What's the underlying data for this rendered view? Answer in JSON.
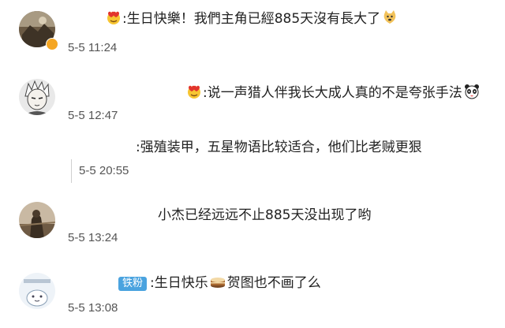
{
  "comments": [
    {
      "text": ":生日快樂！我們主角已經885天沒有長大了",
      "time": "5-5 11:24",
      "leading_emoji": "heart-face-emoji",
      "trailing_emoji": "doge-emoji"
    },
    {
      "text": ":说一声猎人伴我长大成人真的不是夸张手法",
      "time": "5-5 12:47",
      "leading_emoji": "heart-face-emoji",
      "trailing_emoji": "panda-face-emoji"
    },
    {
      "text": ":强殖装甲，五星物语比较适合，他们比老贼更狠",
      "time": "5-5 20:55"
    },
    {
      "text": "小杰已经远远不止885天没出现了哟",
      "time": "5-5 13:24"
    },
    {
      "badge": "铁粉",
      "text_before": ":生日快乐",
      "text_after": "贺图也不画了么",
      "time": "5-5 13:08",
      "inline_emoji": "cake-emoji"
    }
  ],
  "colors": {
    "badge_fan": "#4aa3df",
    "vip_badge": "#f5a623",
    "time_text": "#555555"
  }
}
